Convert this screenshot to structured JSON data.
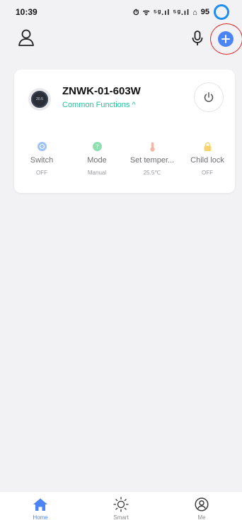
{
  "status": {
    "time": "10:39",
    "icons": "⏱ ᯤ ⁵ᵍ.ıl ⁵ᵍ.ıl ⌂",
    "battery": "95"
  },
  "topbar": {
    "profile_icon": "person-outline-icon",
    "mic_icon": "microphone-icon",
    "add_icon": "plus-circle-icon"
  },
  "device": {
    "name": "ZNWK-01-603W",
    "common_functions": "Common Functions ^",
    "thumbnail_text": "20.5",
    "functions": [
      {
        "label": "Switch",
        "value": "OFF",
        "icon": "power-dot-icon",
        "color": "#9cc3f5"
      },
      {
        "label": "Mode",
        "value": "Manual",
        "icon": "question-dot-icon",
        "color": "#8ee0b0"
      },
      {
        "label": "Set temper...",
        "value": "25.5℃",
        "icon": "thermometer-icon",
        "color": "#f5b7a8"
      },
      {
        "label": "Child lock",
        "value": "OFF",
        "icon": "lock-icon",
        "color": "#f7d470"
      }
    ]
  },
  "nav": {
    "items": [
      {
        "label": "Home",
        "icon": "home-icon",
        "active": true
      },
      {
        "label": "Smart",
        "icon": "sun-icon",
        "active": false
      },
      {
        "label": "Me",
        "icon": "person-circle-icon",
        "active": false
      }
    ]
  },
  "colors": {
    "accent": "#4b84f5",
    "common_functions": "#1ec6a0",
    "highlight": "#e02a2a",
    "background": "#f2f2f4"
  }
}
